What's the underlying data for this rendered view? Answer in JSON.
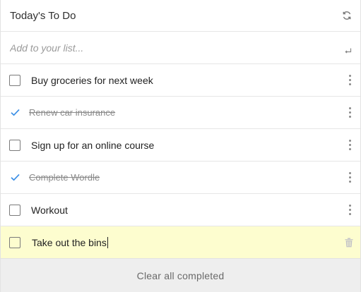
{
  "header": {
    "title": "Today's To Do",
    "refresh_icon": "refresh-icon"
  },
  "add": {
    "placeholder": "Add to your list...",
    "value": "",
    "enter_icon": "enter-icon"
  },
  "items": [
    {
      "label": "Buy groceries for next week",
      "done": false
    },
    {
      "label": "Renew car insurance",
      "done": true
    },
    {
      "label": "Sign up for an online course",
      "done": false
    },
    {
      "label": "Complete Wordle",
      "done": true
    },
    {
      "label": "Workout",
      "done": false
    },
    {
      "label": "Take out the bins",
      "done": false,
      "editing": true
    }
  ],
  "footer": {
    "clear_label": "Clear all completed"
  },
  "colors": {
    "accent": "#3a8ee6",
    "editing_bg": "#fdfdcf",
    "footer_bg": "#eeeeee"
  }
}
